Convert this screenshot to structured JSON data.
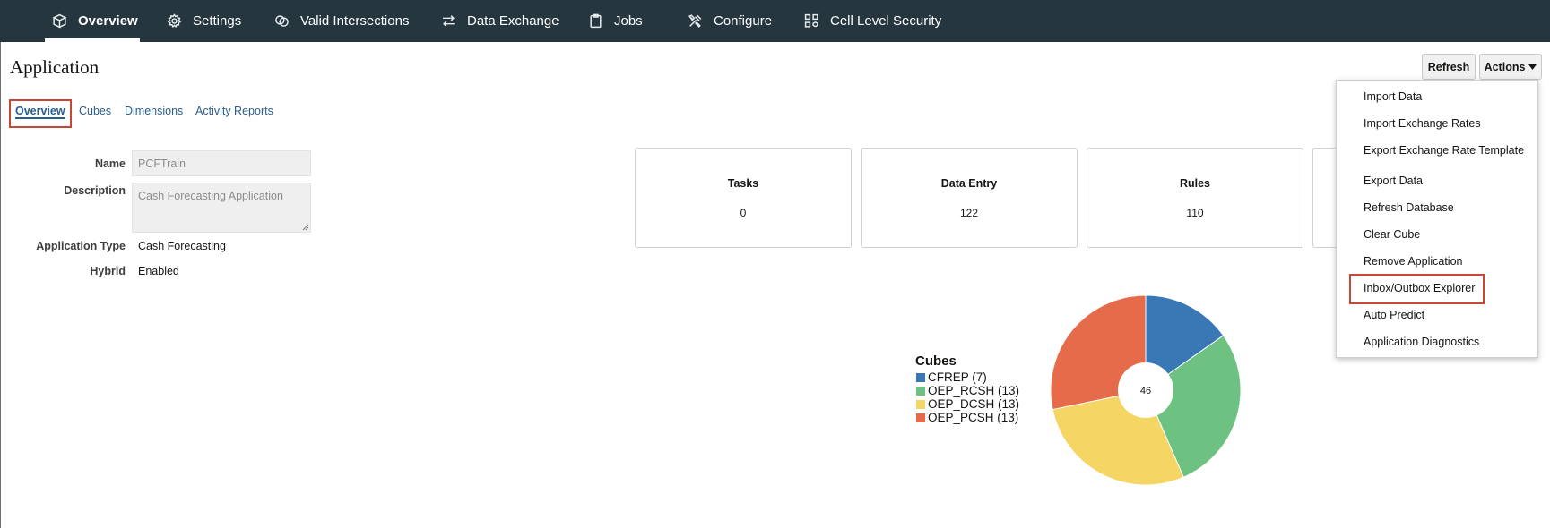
{
  "nav": {
    "tabs": [
      {
        "label": "Overview",
        "icon": "cube-stack-icon",
        "active": true
      },
      {
        "label": "Settings",
        "icon": "gear-icon"
      },
      {
        "label": "Valid Intersections",
        "icon": "intersection-icon"
      },
      {
        "label": "Data Exchange",
        "icon": "exchange-arrows-icon"
      },
      {
        "label": "Jobs",
        "icon": "clipboard-icon"
      },
      {
        "label": "Configure",
        "icon": "tools-icon"
      },
      {
        "label": "Cell Level Security",
        "icon": "grid-security-icon"
      }
    ]
  },
  "page": {
    "title": "Application",
    "subtabs": [
      "Overview",
      "Cubes",
      "Dimensions",
      "Activity Reports"
    ]
  },
  "toolbar": {
    "refresh_label": "Refresh",
    "actions_label": "Actions",
    "actions_icon": "caret-down-icon"
  },
  "actions_menu": [
    "Import Data",
    "Import Exchange Rates",
    "Export Exchange Rate Template",
    "Export Data",
    "Refresh Database",
    "Clear Cube",
    "Remove Application",
    "Inbox/Outbox Explorer",
    "Auto Predict",
    "Application Diagnostics"
  ],
  "details": {
    "name_label": "Name",
    "name_value": "PCFTrain",
    "description_label": "Description",
    "description_value": "Cash Forecasting Application",
    "type_label": "Application Type",
    "type_value": "Cash Forecasting",
    "hybrid_label": "Hybrid",
    "hybrid_value": "Enabled"
  },
  "cards": [
    {
      "title": "Tasks",
      "value": "0"
    },
    {
      "title": "Data Entry",
      "value": "122"
    },
    {
      "title": "Rules",
      "value": "110"
    }
  ],
  "colors": {
    "nav_bg": "#26363f",
    "link": "#2c5e8d",
    "highlight": "#c74634"
  },
  "chart_data": {
    "type": "pie",
    "title": "Cubes",
    "center_label": "46",
    "legend_placement": "left",
    "slices": [
      {
        "label": "CFREP (7)",
        "value": 7,
        "color": "#3a78b5"
      },
      {
        "label": "OEP_RCSH (13)",
        "value": 13,
        "color": "#6dc282"
      },
      {
        "label": "OEP_DCSH (13)",
        "value": 13,
        "color": "#f5d563"
      },
      {
        "label": "OEP_PCSH (13)",
        "value": 13,
        "color": "#e56b4a"
      }
    ]
  }
}
